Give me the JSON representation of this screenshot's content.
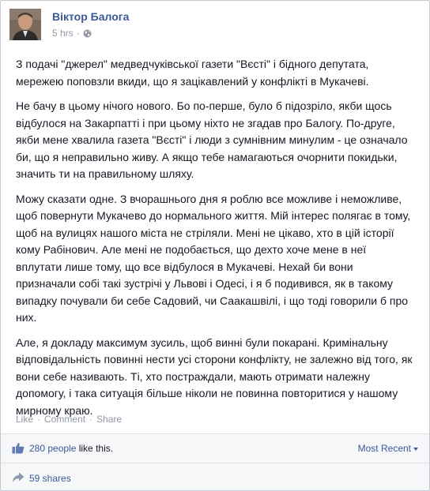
{
  "post": {
    "author": "Віктор Балога",
    "time": "5 hrs",
    "separator": "·",
    "privacy_icon": "globe-icon",
    "paragraphs": [
      "З подачі \"джерел\" медведчуківської газети \"Вєсті\" і бідного депутата, мережею поповзли вкиди, що я зацікавлений у конфлікті в Мукачеві.",
      "Не бачу в цьому нічого нового. Бо по-перше, було б підозріло, якби щось відбулося на Закарпатті і при цьому ніхто не згадав про Балогу. По-друге, якби мене хвалила газета \"Вєсті\" і люди з сумнівним минулим - це означало би, що я неправильно живу. А якщо тебе намагаються очорнити покидьки, значить ти на правильному шляху.",
      "Можу сказати одне. З вчорашнього дня я роблю все можливе і неможливе, щоб повернути Мукачево до нормального життя. Мій інтерес полягає в тому, щоб на вулицях нашого міста не стріляли. Мені не цікаво, хто в цій історії кому Рабінович. Але мені не подобається, що дехто хоче мене в неї вплутати лише тому, що все відбулося в Мукачеві. Нехай би вони призначали собі такі зустрічі у Львові і Одесі, і я б подивився, як в такому випадку почували би себе Садовий, чи Саакашвілі, і що тоді говорили б про них.",
      "Але, я докладу максимум зусиль, щоб винні були покарані. Кримінальну відповідальність повинні нести усі сторони конфлікту, не залежно від того, як вони себе називають. Ті, хто постраждали, мають отримати належну допомогу, і така ситуація більше ніколи не повинна повторитися у нашому мирному краю."
    ]
  },
  "actions": {
    "like": "Like",
    "comment": "Comment",
    "share": "Share",
    "separator": "·"
  },
  "ufi": {
    "likes_count": "280 people",
    "likes_suffix": " like this.",
    "sort_label": "Most Recent",
    "shares": "59 shares",
    "like_icon": "thumbs-up-icon",
    "share_icon": "share-arrow-icon"
  },
  "colors": {
    "link": "#3b5998",
    "text": "#141823",
    "muted": "#9197a3",
    "ufi_bg": "#f6f7f8",
    "border": "#c4c9d4"
  }
}
